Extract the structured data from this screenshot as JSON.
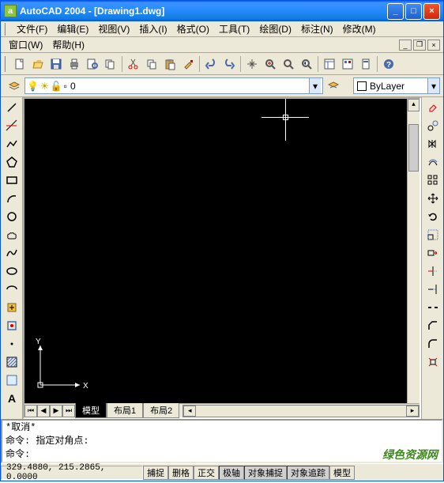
{
  "app": {
    "name": "AutoCAD 2004",
    "doc": "[Drawing1.dwg]"
  },
  "menu": {
    "file": "文件(F)",
    "edit": "编辑(E)",
    "view": "视图(V)",
    "insert": "插入(I)",
    "format": "格式(O)",
    "tools": "工具(T)",
    "draw": "绘图(D)",
    "label": "标注(N)",
    "modify": "修改(M)",
    "window": "窗口(W)",
    "help": "帮助(H)"
  },
  "layer": {
    "current": "0",
    "bylayer": "ByLayer"
  },
  "tabs": {
    "model": "模型",
    "layout1": "布局1",
    "layout2": "布局2"
  },
  "ucs": {
    "x": "X",
    "y": "Y"
  },
  "cmd": {
    "line1": "*取消*",
    "line2": "命令: 指定对角点:",
    "line3": "命令:"
  },
  "status": {
    "coords": "329.4880, 215.2865, 0.0000",
    "snap": "捕捉",
    "grid": "删格",
    "ortho": "正交",
    "polar": "极轴",
    "osnap": "对象捕捉",
    "otrack": "对象追踪",
    "model": "模型"
  },
  "watermark": "绿色资源网"
}
